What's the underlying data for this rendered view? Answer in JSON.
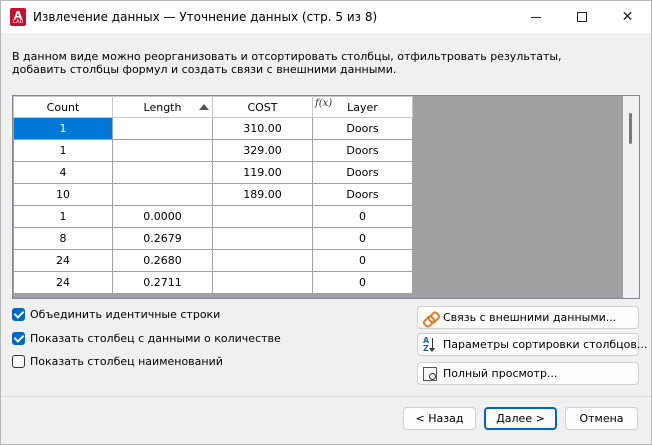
{
  "window": {
    "title": "Извлечение данных — Уточнение данных (стр. 5 из 8)",
    "app_icon_letter": "A",
    "app_icon_sub": "CAD"
  },
  "description": {
    "line1": "В данном виде можно реорганизовать и отсортировать столбцы, отфильтровать результаты,",
    "line2": "добавить столбцы формул и создать связи с внешними данными."
  },
  "grid": {
    "columns": [
      "Count",
      "Length",
      "COST",
      "Layer"
    ],
    "sorted_column": "Length",
    "formula_column": "Layer",
    "rows": [
      [
        "1",
        "",
        "310.00",
        "Doors"
      ],
      [
        "1",
        "",
        "329.00",
        "Doors"
      ],
      [
        "4",
        "",
        "119.00",
        "Doors"
      ],
      [
        "10",
        "",
        "189.00",
        "Doors"
      ],
      [
        "1",
        "0.0000",
        "",
        "0"
      ],
      [
        "8",
        "0.2679",
        "",
        "0"
      ],
      [
        "24",
        "0.2680",
        "",
        "0"
      ],
      [
        "24",
        "0.2711",
        "",
        "0"
      ]
    ]
  },
  "options": {
    "combine_identical": {
      "label": "Объединить идентичные строки",
      "checked": true
    },
    "show_count": {
      "label": "Показать столбец с данными о количестве",
      "checked": true
    },
    "show_name": {
      "label": "Показать столбец наименований",
      "checked": false
    }
  },
  "actions": {
    "link_external": "Связь с внешними данными...",
    "sort_params": "Параметры сортировки столбцов...",
    "full_preview": "Полный просмотр..."
  },
  "footer": {
    "back": "< Назад",
    "next": "Далее >",
    "cancel": "Отмена"
  },
  "colors": {
    "accent": "#0067c0",
    "selection": "#0078d7",
    "grid_bg": "#a0a0a0",
    "app_icon": "#c8102e"
  }
}
